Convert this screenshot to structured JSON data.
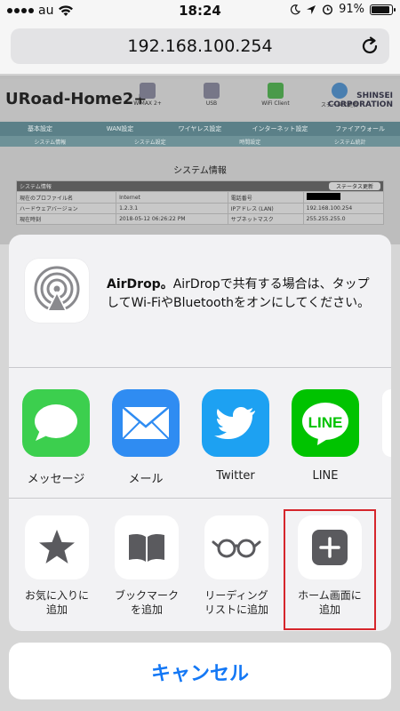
{
  "status_bar": {
    "carrier": "au",
    "time": "18:24",
    "battery": "91%",
    "battery_level": 0.91,
    "icons": [
      "signal-dots",
      "wifi-icon",
      "moon-icon",
      "location-icon",
      "alarm-icon",
      "battery-icon"
    ]
  },
  "browser": {
    "url": "192.168.100.254",
    "reload_icon": "reload-icon"
  },
  "webpage": {
    "brand": "URoad-Home2+",
    "header_icons": [
      {
        "label": "WiMAX 2+"
      },
      {
        "label": "USB"
      },
      {
        "label": "WiFi Client"
      },
      {
        "label": "ステータス更新"
      }
    ],
    "corp_line1": "SHINSEI",
    "corp_line2": "CORPORATION",
    "nav": [
      "基本設定",
      "WAN設定",
      "ワイヤレス設定",
      "インターネット設定",
      "ファイアウォール"
    ],
    "subnav": [
      "システム情報",
      "システム設定",
      "時間設定",
      "システム統計"
    ],
    "title": "システム情報",
    "table": {
      "header_left": "システム情報",
      "header_button": "ステータス更新",
      "rows": [
        [
          "現在のプロファイル名",
          "Internet",
          "電話番号",
          ""
        ],
        [
          "ハードウェアバージョン",
          "1.2.3.1",
          "IPアドレス (LAN)",
          "192.168.100.254"
        ],
        [
          "現在時刻",
          "2018-05-12 06:26:22 PM",
          "サブネットマスク",
          "255.255.255.0"
        ]
      ]
    }
  },
  "share_sheet": {
    "airdrop": {
      "title": "AirDrop。",
      "description": "AirDropで共有する場合は、タップしてWi-FiやBluetoothをオンにしてください。"
    },
    "apps": [
      {
        "label": "メッセージ",
        "icon": "messages-icon",
        "color": "#3ccf4e"
      },
      {
        "label": "メール",
        "icon": "mail-icon",
        "color": "#2f8cf2"
      },
      {
        "label": "Twitter",
        "icon": "twitter-icon",
        "color": "#1da1f2"
      },
      {
        "label": "LINE",
        "icon": "line-icon",
        "color": "#00c300"
      }
    ],
    "actions": [
      {
        "label_line1": "お気に入りに",
        "label_line2": "追加",
        "icon": "star-icon"
      },
      {
        "label_line1": "ブックマーク",
        "label_line2": "を追加",
        "icon": "book-icon"
      },
      {
        "label_line1": "リーディング",
        "label_line2": "リストに追加",
        "icon": "glasses-icon"
      },
      {
        "label_line1": "ホーム画面に",
        "label_line2": "追加",
        "icon": "add-square-icon"
      }
    ],
    "highlight_color": "#d6262c"
  },
  "cancel_label": "キャンセル",
  "accent_color": "#1478f5"
}
